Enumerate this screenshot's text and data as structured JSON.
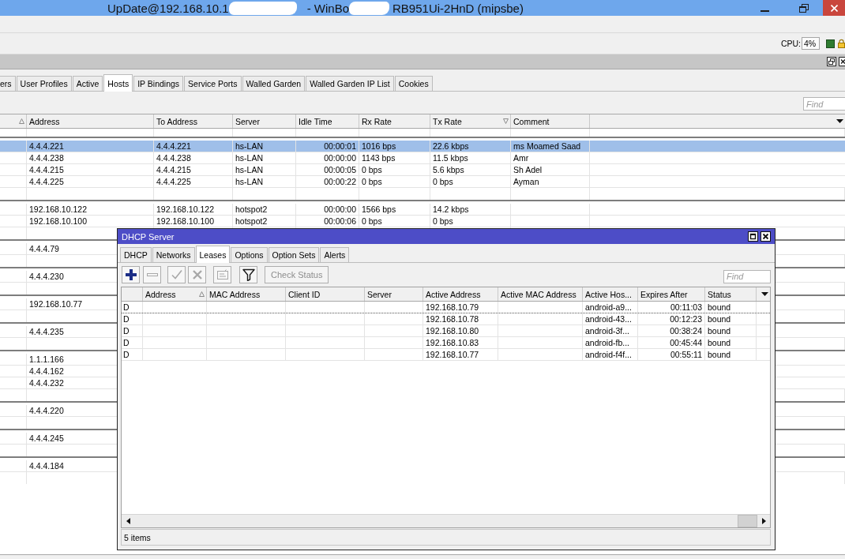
{
  "window": {
    "title_parts": [
      "UpDate@192.168.10.1",
      "- WinBo",
      "RB951Ui-2HnD (mipsbe)"
    ]
  },
  "status": {
    "cpu_label": "CPU:",
    "cpu_value": "4%"
  },
  "hotspot": {
    "tabs": [
      {
        "label": "ers",
        "selected": false
      },
      {
        "label": "User Profiles",
        "selected": false
      },
      {
        "label": "Active",
        "selected": false
      },
      {
        "label": "Hosts",
        "selected": true
      },
      {
        "label": "IP Bindings",
        "selected": false
      },
      {
        "label": "Service Ports",
        "selected": false
      },
      {
        "label": "Walled Garden",
        "selected": false
      },
      {
        "label": "Walled Garden IP List",
        "selected": false
      },
      {
        "label": "Cookies",
        "selected": false
      }
    ],
    "find": {
      "placeholder": "Find"
    },
    "columns": [
      {
        "kind": "flag",
        "sort_ascending": true,
        "sort_descending": false
      },
      {
        "label": "Address",
        "kind": "text",
        "sort_ascending": false,
        "sort_descending": false
      },
      {
        "label": "To Address",
        "kind": "text",
        "sort_ascending": false,
        "sort_descending": false
      },
      {
        "label": "Server",
        "kind": "text",
        "sort_ascending": false,
        "sort_descending": false
      },
      {
        "label": "Idle Time",
        "kind": "duration",
        "sort_ascending": false,
        "sort_descending": false
      },
      {
        "label": "Rx Rate",
        "kind": "text",
        "sort_ascending": false,
        "sort_descending": false
      },
      {
        "label": "Tx Rate",
        "kind": "text",
        "sort_ascending": false,
        "sort_descending": true
      },
      {
        "label": "Comment",
        "kind": "text",
        "sort_ascending": false,
        "sort_descending": false
      }
    ],
    "groups": [
      {
        "rows": [
          {
            "cells": [
              null,
              "4.4.4.221",
              "4.4.4.221",
              "hs-LAN",
              "00:00:01",
              "1016 bps",
              "22.6 kbps",
              "ms Moamed Saad"
            ],
            "selected": true
          },
          {
            "cells": [
              null,
              "4.4.4.238",
              "4.4.4.238",
              "hs-LAN",
              "00:00:00",
              "1143 bps",
              "11.5 kbps",
              "Amr"
            ],
            "selected": false
          },
          {
            "cells": [
              null,
              "4.4.4.215",
              "4.4.4.215",
              "hs-LAN",
              "00:00:05",
              "0 bps",
              "5.6 kbps",
              "Sh Adel"
            ],
            "selected": false
          },
          {
            "cells": [
              null,
              "4.4.4.225",
              "4.4.4.225",
              "hs-LAN",
              "00:00:22",
              "0 bps",
              "0 bps",
              "Ayman"
            ],
            "selected": false
          }
        ]
      },
      {
        "rows": [
          {
            "cells": [
              null,
              "192.168.10.122",
              "192.168.10.122",
              "hotspot2",
              "00:00:00",
              "1566 bps",
              "14.2 kbps"
            ],
            "selected": false
          },
          {
            "cells": [
              null,
              "192.168.10.100",
              "192.168.10.100",
              "hotspot2",
              "00:00:06",
              "0 bps",
              "0 bps"
            ],
            "selected": false
          }
        ]
      },
      {
        "rows": [
          {
            "cells": [
              null,
              "4.4.4.79"
            ],
            "selected": false
          }
        ]
      },
      {
        "rows": [
          {
            "cells": [
              null,
              "4.4.4.230"
            ],
            "selected": false
          }
        ]
      },
      {
        "rows": [
          {
            "cells": [
              null,
              "192.168.10.77"
            ],
            "selected": false
          }
        ]
      },
      {
        "rows": [
          {
            "cells": [
              null,
              "4.4.4.235"
            ],
            "selected": false
          }
        ]
      },
      {
        "rows": [
          {
            "cells": [
              null,
              "1.1.1.166"
            ],
            "selected": false
          },
          {
            "cells": [
              null,
              "4.4.4.162"
            ],
            "selected": false
          },
          {
            "cells": [
              null,
              "4.4.4.232"
            ],
            "selected": false
          }
        ]
      },
      {
        "rows": [
          {
            "cells": [
              null,
              "4.4.4.220"
            ],
            "selected": false
          }
        ]
      },
      {
        "rows": [
          {
            "cells": [
              null,
              "4.4.4.245"
            ],
            "selected": false
          }
        ]
      },
      {
        "rows": [
          {
            "cells": [
              null,
              "4.4.4.184"
            ],
            "selected": false
          }
        ]
      }
    ]
  },
  "dhcp": {
    "title": "DHCP Server",
    "tabs": [
      {
        "label": "DHCP",
        "selected": false
      },
      {
        "label": "Networks",
        "selected": false
      },
      {
        "label": "Leases",
        "selected": true
      },
      {
        "label": "Options",
        "selected": false
      },
      {
        "label": "Option Sets",
        "selected": false
      },
      {
        "label": "Alerts",
        "selected": false
      }
    ],
    "toolbar": [
      {
        "kind": "add",
        "disabled": false
      },
      {
        "kind": "remove",
        "disabled": true
      },
      {
        "kind": "enable",
        "disabled": true
      },
      {
        "kind": "disable",
        "disabled": true
      },
      {
        "kind": "comment",
        "disabled": true
      },
      {
        "kind": "filter",
        "disabled": false
      }
    ],
    "check_status": {
      "label": "Check Status",
      "disabled": true
    },
    "find": {
      "placeholder": "Find"
    },
    "columns": [
      {
        "kind": "flag",
        "sort_ascending": false,
        "sort_descending": false
      },
      {
        "label": "Address",
        "kind": "text",
        "sort_ascending": true,
        "sort_descending": false
      },
      {
        "label": "MAC Address",
        "kind": "text",
        "sort_ascending": false,
        "sort_descending": false
      },
      {
        "label": "Client ID",
        "kind": "text",
        "sort_ascending": false,
        "sort_descending": false
      },
      {
        "label": "Server",
        "kind": "text",
        "sort_ascending": false,
        "sort_descending": false
      },
      {
        "label": "Active Address",
        "kind": "text",
        "sort_ascending": false,
        "sort_descending": false
      },
      {
        "label": "Active MAC Address",
        "kind": "text",
        "sort_ascending": false,
        "sort_descending": false
      },
      {
        "label": "Active Hos...",
        "kind": "text",
        "sort_ascending": false,
        "sort_descending": false
      },
      {
        "label": "Expires After",
        "kind": "duration",
        "sort_ascending": false,
        "sort_descending": false
      },
      {
        "label": "Status",
        "kind": "text",
        "sort_ascending": false,
        "sort_descending": false
      }
    ],
    "rows": [
      {
        "cells": [
          "D",
          null,
          null,
          null,
          null,
          "192.168.10.79",
          null,
          "android-a9...",
          "00:11:03",
          "bound"
        ],
        "selected": false,
        "focused": true
      },
      {
        "cells": [
          "D",
          null,
          null,
          null,
          null,
          "192.168.10.78",
          null,
          "android-43...",
          "00:12:23",
          "bound"
        ],
        "selected": false,
        "focused": false
      },
      {
        "cells": [
          "D",
          null,
          null,
          null,
          null,
          "192.168.10.80",
          null,
          "android-3f...",
          "00:38:24",
          "bound"
        ],
        "selected": false,
        "focused": false
      },
      {
        "cells": [
          "D",
          null,
          null,
          null,
          null,
          "192.168.10.83",
          null,
          "android-fb...",
          "00:45:44",
          "bound"
        ],
        "selected": false,
        "focused": false
      },
      {
        "cells": [
          "D",
          null,
          null,
          null,
          null,
          "192.168.10.77",
          null,
          "android-f4f...",
          "00:55:11",
          "bound"
        ],
        "selected": false,
        "focused": false
      }
    ],
    "status": "5 items"
  }
}
